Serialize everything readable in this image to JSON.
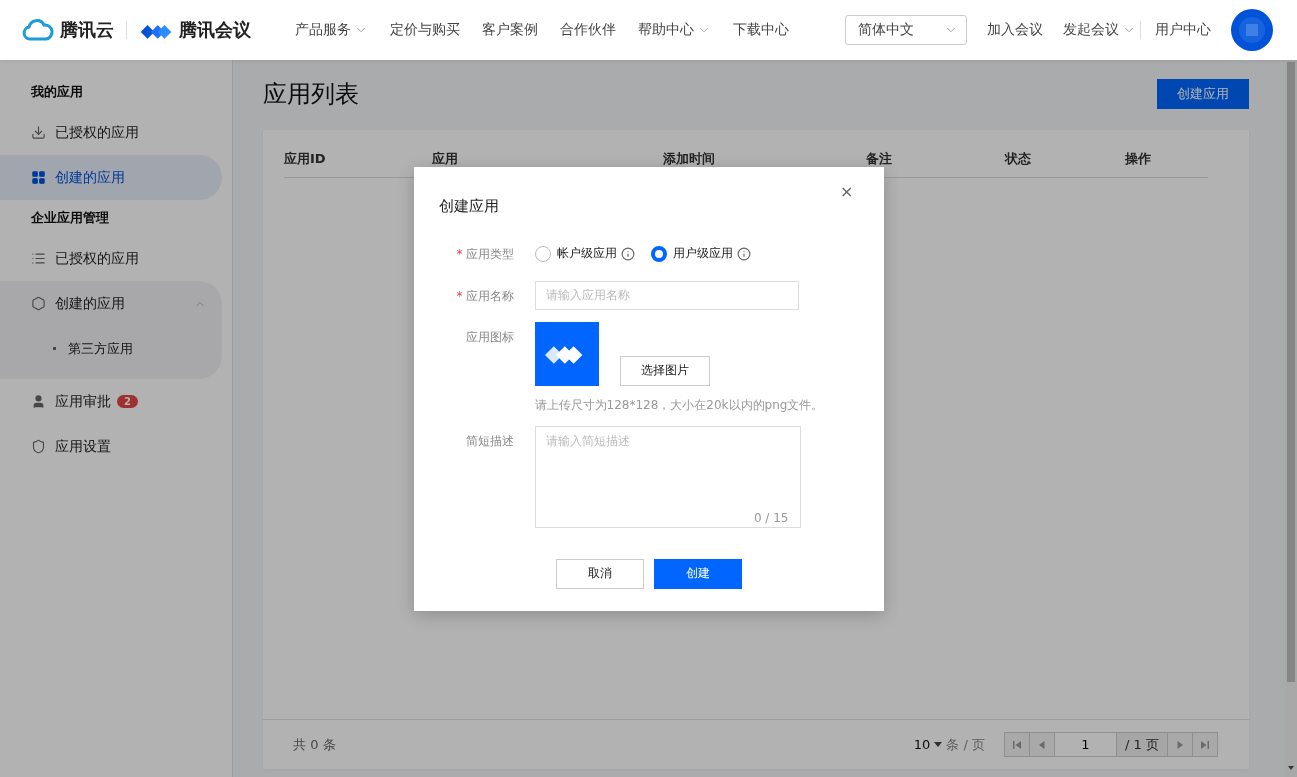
{
  "header": {
    "brand": "腾讯云",
    "product": "腾讯会议",
    "nav": [
      {
        "label": "产品服务",
        "dropdown": true
      },
      {
        "label": "定价与购买",
        "dropdown": false
      },
      {
        "label": "客户案例",
        "dropdown": false
      },
      {
        "label": "合作伙伴",
        "dropdown": false
      },
      {
        "label": "帮助中心",
        "dropdown": true
      },
      {
        "label": "下载中心",
        "dropdown": false
      }
    ],
    "language": "简体中文",
    "actions": [
      {
        "label": "加入会议",
        "dropdown": false
      },
      {
        "label": "发起会议",
        "dropdown": true
      }
    ],
    "user_center": "用户中心"
  },
  "sidebar": {
    "sections": [
      {
        "title": "我的应用",
        "items": [
          {
            "label": "已授权的应用",
            "selected": false
          },
          {
            "label": "创建的应用",
            "selected": true
          }
        ]
      },
      {
        "title": "企业应用管理",
        "items": [
          {
            "label": "已授权的应用",
            "selected": false
          },
          {
            "label": "创建的应用",
            "selected": false,
            "expanded": true,
            "children": [
              {
                "label": "第三方应用",
                "selected": false
              }
            ]
          },
          {
            "label": "应用审批",
            "selected": false,
            "badge": "2"
          },
          {
            "label": "应用设置",
            "selected": false
          }
        ]
      }
    ]
  },
  "page": {
    "title": "应用列表",
    "create_button": "创建应用",
    "table": {
      "columns": [
        "应用ID",
        "应用",
        "添加时间",
        "备注",
        "状态",
        "操作"
      ]
    },
    "footer": {
      "total": "共 0 条",
      "page_size": "10",
      "page_size_unit": "条 / 页",
      "page": "1",
      "page_count": "/ 1 页"
    }
  },
  "dialog": {
    "title": "创建应用",
    "close": "×",
    "fields": [
      {
        "kind": "radio",
        "label": "应用类型",
        "marker": "*",
        "options": [
          {
            "label": "帐户级应用",
            "selected": false
          },
          {
            "label": "用户级应用",
            "selected": true
          }
        ]
      },
      {
        "kind": "input",
        "label": "应用名称",
        "marker": "*",
        "placeholder": "请输入应用名称"
      },
      {
        "kind": "image",
        "label": "应用图标",
        "button": "选择图片",
        "hint": "请上传尺寸为128*128，大小在20k以内的png文件。"
      },
      {
        "kind": "textarea",
        "label": "简短描述",
        "placeholder": "请输入简短描述",
        "counter": "0 / 15"
      }
    ],
    "buttons": [
      {
        "label": "取消",
        "primary": false
      },
      {
        "label": "创建",
        "primary": true
      }
    ]
  }
}
